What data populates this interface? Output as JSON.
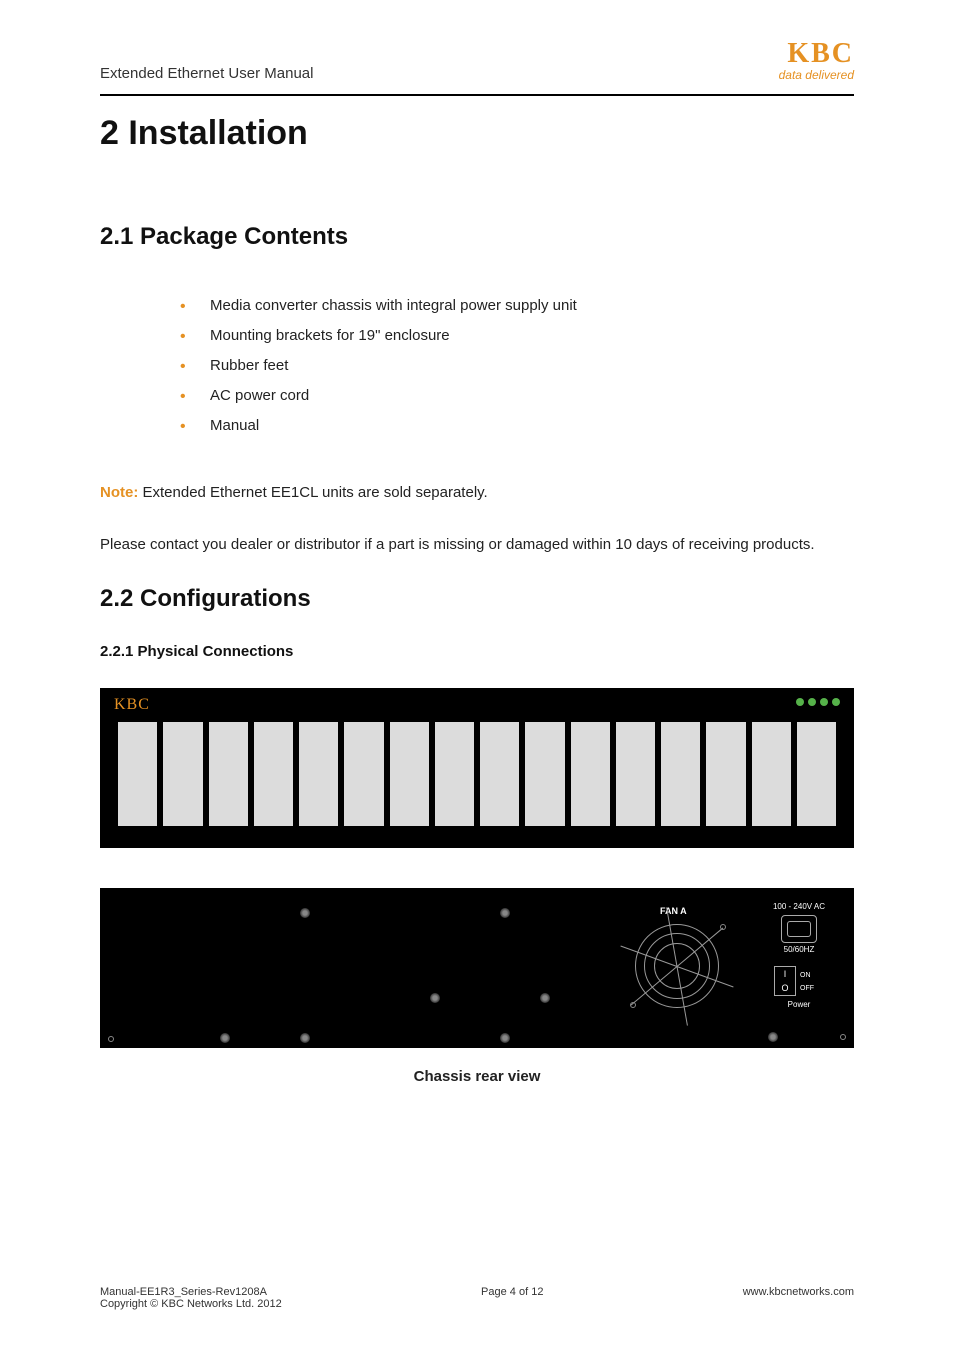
{
  "header": {
    "title": "Extended Ethernet User Manual",
    "logo_text": "KBC",
    "logo_sub": "data delivered"
  },
  "h1": "2 Installation",
  "section1": {
    "heading": "2.1  Package Contents",
    "items": [
      "Media converter chassis with integral power supply unit",
      "Mounting brackets for 19\" enclosure",
      "Rubber feet",
      "AC power cord",
      "Manual"
    ],
    "note_label": "Note:",
    "note_text": " Extended Ethernet EE1CL units are sold separately.",
    "contact": "Please contact you dealer or distributor if a part is missing or damaged within 10 days of receiving products."
  },
  "section2": {
    "heading": "2.2  Configurations",
    "sub_heading": "2.2.1  Physical Connections",
    "front_brand": "KBC",
    "rear": {
      "fan_label": "FAN A",
      "ac_top": "100 - 240V AC",
      "hz": "50/60HZ",
      "on": "ON",
      "off": "OFF",
      "power": "Power",
      "switch_i": "I",
      "switch_o": "O"
    },
    "caption": "Chassis rear view"
  },
  "footer": {
    "doc": "Manual-EE1R3_Series-Rev1208A",
    "copyright": "Copyright © KBC Networks Ltd. 2012",
    "page": "Page 4 of 12",
    "url": "www.kbcnetworks.com"
  }
}
